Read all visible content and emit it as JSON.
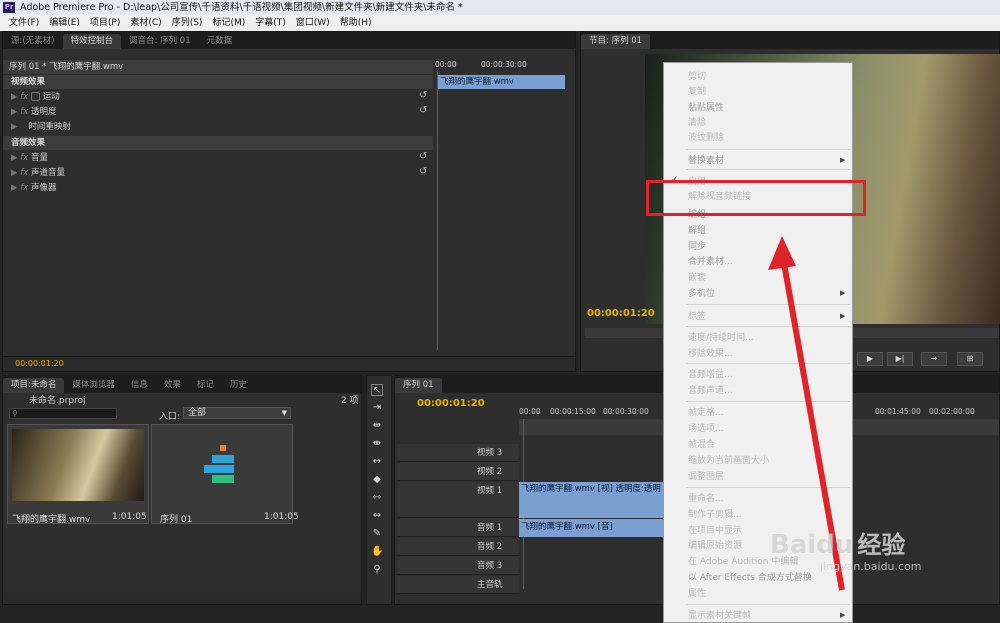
{
  "app": {
    "title": "Adobe Premiere Pro - D:\\leap\\公司宣传\\千语资料\\千语视频\\集团视频\\新建文件夹\\新建文件夹\\未命名 *",
    "icon": "Pr"
  },
  "menubar": [
    "文件(F)",
    "编辑(E)",
    "项目(P)",
    "素材(C)",
    "序列(S)",
    "标记(M)",
    "字幕(T)",
    "窗口(W)",
    "帮助(H)"
  ],
  "effects_panel": {
    "tabs": [
      "源:(无素材)",
      "特效控制台",
      "调音台: 序列 01",
      "元数据"
    ],
    "seq_label": "序列 01 * 飞翔的鹰宇翻.wmv",
    "timecode_start": "00:00",
    "timecode_mid": "00:00:30:00",
    "clip_label": "飞翔的鹰宇翻.wmv",
    "video_header": "视频效果",
    "video_items": [
      "运动",
      "透明度",
      "时间重映射"
    ],
    "audio_header": "音频效果",
    "audio_items": [
      "音量",
      "声道音量",
      "声像器"
    ],
    "fx": "fx",
    "timecode": "00:00:01:20"
  },
  "program_panel": {
    "tab": "节目: 序列 01",
    "timecode": "00:00:01:20"
  },
  "project_panel": {
    "tabs": [
      "项目:未命名",
      "媒体浏览器",
      "信息",
      "效果",
      "标记",
      "历史"
    ],
    "project_file": "未命名.prproj",
    "count": "2 项",
    "inpoint_label": "入口:",
    "inpoint_value": "全部",
    "items": [
      {
        "name": "飞翔的鹰宇翻.wmv",
        "duration": "1:01:05"
      },
      {
        "name": "序列 01",
        "duration": "1:01:05"
      }
    ]
  },
  "timeline": {
    "tab": "序列 01",
    "timecode": "00:00:01:20",
    "ruler": [
      "00:00",
      "00:00:15:00",
      "00:00:30:00"
    ],
    "ruler_right": [
      "00:01:45:00",
      "00:02:00:00"
    ],
    "tracks": [
      "视频 3",
      "视频 2",
      "视频 1",
      "音频 1",
      "音频 2",
      "音频 3",
      "主音轨"
    ],
    "video_clip": "飞翔的鹰宇翻.wmv [视] 透明度:透明",
    "audio_clip": "飞翔的鹰宇翻.wmv [音]"
  },
  "context_menu": {
    "items": [
      {
        "label": "剪切",
        "disabled": false
      },
      {
        "label": "复制",
        "disabled": false
      },
      {
        "label": "粘贴属性",
        "disabled": true
      },
      {
        "label": "清除",
        "disabled": false
      },
      {
        "label": "波纹删除",
        "disabled": false
      },
      {
        "label": "替换素材",
        "disabled": true,
        "submenu": true
      },
      {
        "label": "启用",
        "disabled": false,
        "checked": true
      },
      {
        "label": "解除视音频链接",
        "disabled": false,
        "highlight": true
      },
      {
        "label": "编组",
        "disabled": true
      },
      {
        "label": "解组",
        "disabled": true
      },
      {
        "label": "同步",
        "disabled": true
      },
      {
        "label": "合并素材...",
        "disabled": true
      },
      {
        "label": "嵌套",
        "disabled": false
      },
      {
        "label": "多机位",
        "disabled": true,
        "submenu": true
      },
      {
        "label": "标签",
        "disabled": false,
        "submenu": true
      },
      {
        "label": "速度/持续时间...",
        "disabled": false
      },
      {
        "label": "移除效果...",
        "disabled": false
      },
      {
        "label": "音频增益...",
        "disabled": false
      },
      {
        "label": "音频声道...",
        "disabled": false
      },
      {
        "label": "帧定格...",
        "disabled": false
      },
      {
        "label": "场选项...",
        "disabled": false
      },
      {
        "label": "帧混合",
        "disabled": false
      },
      {
        "label": "缩放为当前画面大小",
        "disabled": false
      },
      {
        "label": "调整图层",
        "disabled": false
      },
      {
        "label": "重命名...",
        "disabled": false
      },
      {
        "label": "制作子剪辑...",
        "disabled": false
      },
      {
        "label": "在项目中显示",
        "disabled": false
      },
      {
        "label": "编辑原始资源",
        "disabled": false
      },
      {
        "label": "在 Adobe Audition 中编辑",
        "disabled": false
      },
      {
        "label": "以 After Effects 合成方式替换",
        "disabled": true
      },
      {
        "label": "属性",
        "disabled": false
      },
      {
        "label": "显示素材关键帧",
        "disabled": false,
        "submenu": true
      }
    ]
  },
  "watermark": {
    "brand": "Baidu",
    "cn": "经验",
    "url": "jingyan.baidu.com"
  },
  "colors": {
    "accent": "#e8b400",
    "highlight_box": "#e0222a",
    "clip_blue": "#7a9fd0"
  }
}
